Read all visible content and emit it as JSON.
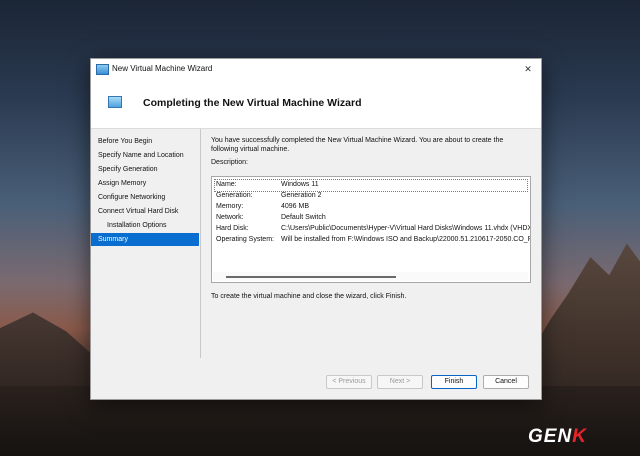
{
  "window": {
    "title": "New Virtual Machine Wizard",
    "close_glyph": "✕",
    "header_title": "Completing the New Virtual Machine Wizard"
  },
  "nav": {
    "items": [
      {
        "label": "Before You Begin"
      },
      {
        "label": "Specify Name and Location"
      },
      {
        "label": "Specify Generation"
      },
      {
        "label": "Assign Memory"
      },
      {
        "label": "Configure Networking"
      },
      {
        "label": "Connect Virtual Hard Disk"
      },
      {
        "label": "Installation Options"
      },
      {
        "label": "Summary"
      }
    ],
    "selected": "Summary"
  },
  "content": {
    "intro": "You have successfully completed the New Virtual Machine Wizard. You are about to create the following virtual machine.",
    "description_label": "Description:",
    "description": [
      {
        "key": "Name:",
        "value": "Windows 11"
      },
      {
        "key": "Generation:",
        "value": "Generation 2"
      },
      {
        "key": "Memory:",
        "value": "4096 MB"
      },
      {
        "key": "Network:",
        "value": "Default Switch"
      },
      {
        "key": "Hard Disk:",
        "value": "C:\\Users\\Public\\Documents\\Hyper-V\\Virtual Hard Disks\\Windows 11.vhdx (VHDX,"
      },
      {
        "key": "Operating System:",
        "value": "Will be installed from F:\\Windows ISO and Backup\\22000.51.210617-2050.CO_R"
      }
    ],
    "finish_note": "To create the virtual machine and close the wizard, click Finish."
  },
  "footer": {
    "previous": "< Previous",
    "next": "Next >",
    "finish": "Finish",
    "cancel": "Cancel"
  },
  "watermark": {
    "prefix": "GEN",
    "accent": "K"
  },
  "colors": {
    "selection": "#0a6ed0",
    "logo_accent": "#e8232a"
  }
}
